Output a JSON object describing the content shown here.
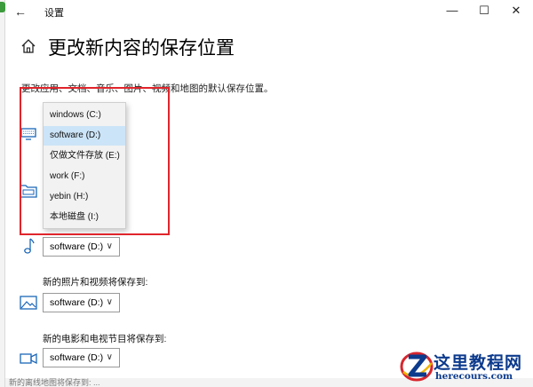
{
  "window": {
    "title": "设置",
    "back_glyph": "←",
    "minimize_glyph": "—",
    "maximize_glyph": "☐",
    "close_glyph": "✕"
  },
  "page": {
    "title": "更改新内容的保存位置",
    "description": "更改应用、文档、音乐、图片、视频和地图的默认保存位置。"
  },
  "dropdown": {
    "items": [
      {
        "label": "windows (C:)",
        "selected": false
      },
      {
        "label": "software (D:)",
        "selected": true
      },
      {
        "label": "仅做文件存放 (E:)",
        "selected": false
      },
      {
        "label": "work (F:)",
        "selected": false
      },
      {
        "label": "yebin (H:)",
        "selected": false
      },
      {
        "label": "本地磁盘 (I:)",
        "selected": false
      }
    ]
  },
  "sections": {
    "apps": {
      "icon": "monitor-icon"
    },
    "documents": {
      "icon": "folder-icon"
    },
    "music": {
      "icon": "music-note-icon",
      "value": "software (D:)"
    },
    "photos": {
      "label": "新的照片和视频将保存到:",
      "icon": "image-icon",
      "value": "software (D:)"
    },
    "movies": {
      "label": "新的电影和电视节目将保存到:",
      "icon": "video-camera-icon",
      "value": "software (D:)"
    }
  },
  "chevron_glyph": "∨",
  "bottom_strip_text": "新的离线地图将保存到: ...",
  "watermark": {
    "title": "这里教程网",
    "url": "herecours.com"
  },
  "colors": {
    "accent_selected": "#cce4f7",
    "highlight_border": "#e0252b",
    "icon_blue": "#1a66b8",
    "watermark_blue": "#0c3a8c"
  }
}
